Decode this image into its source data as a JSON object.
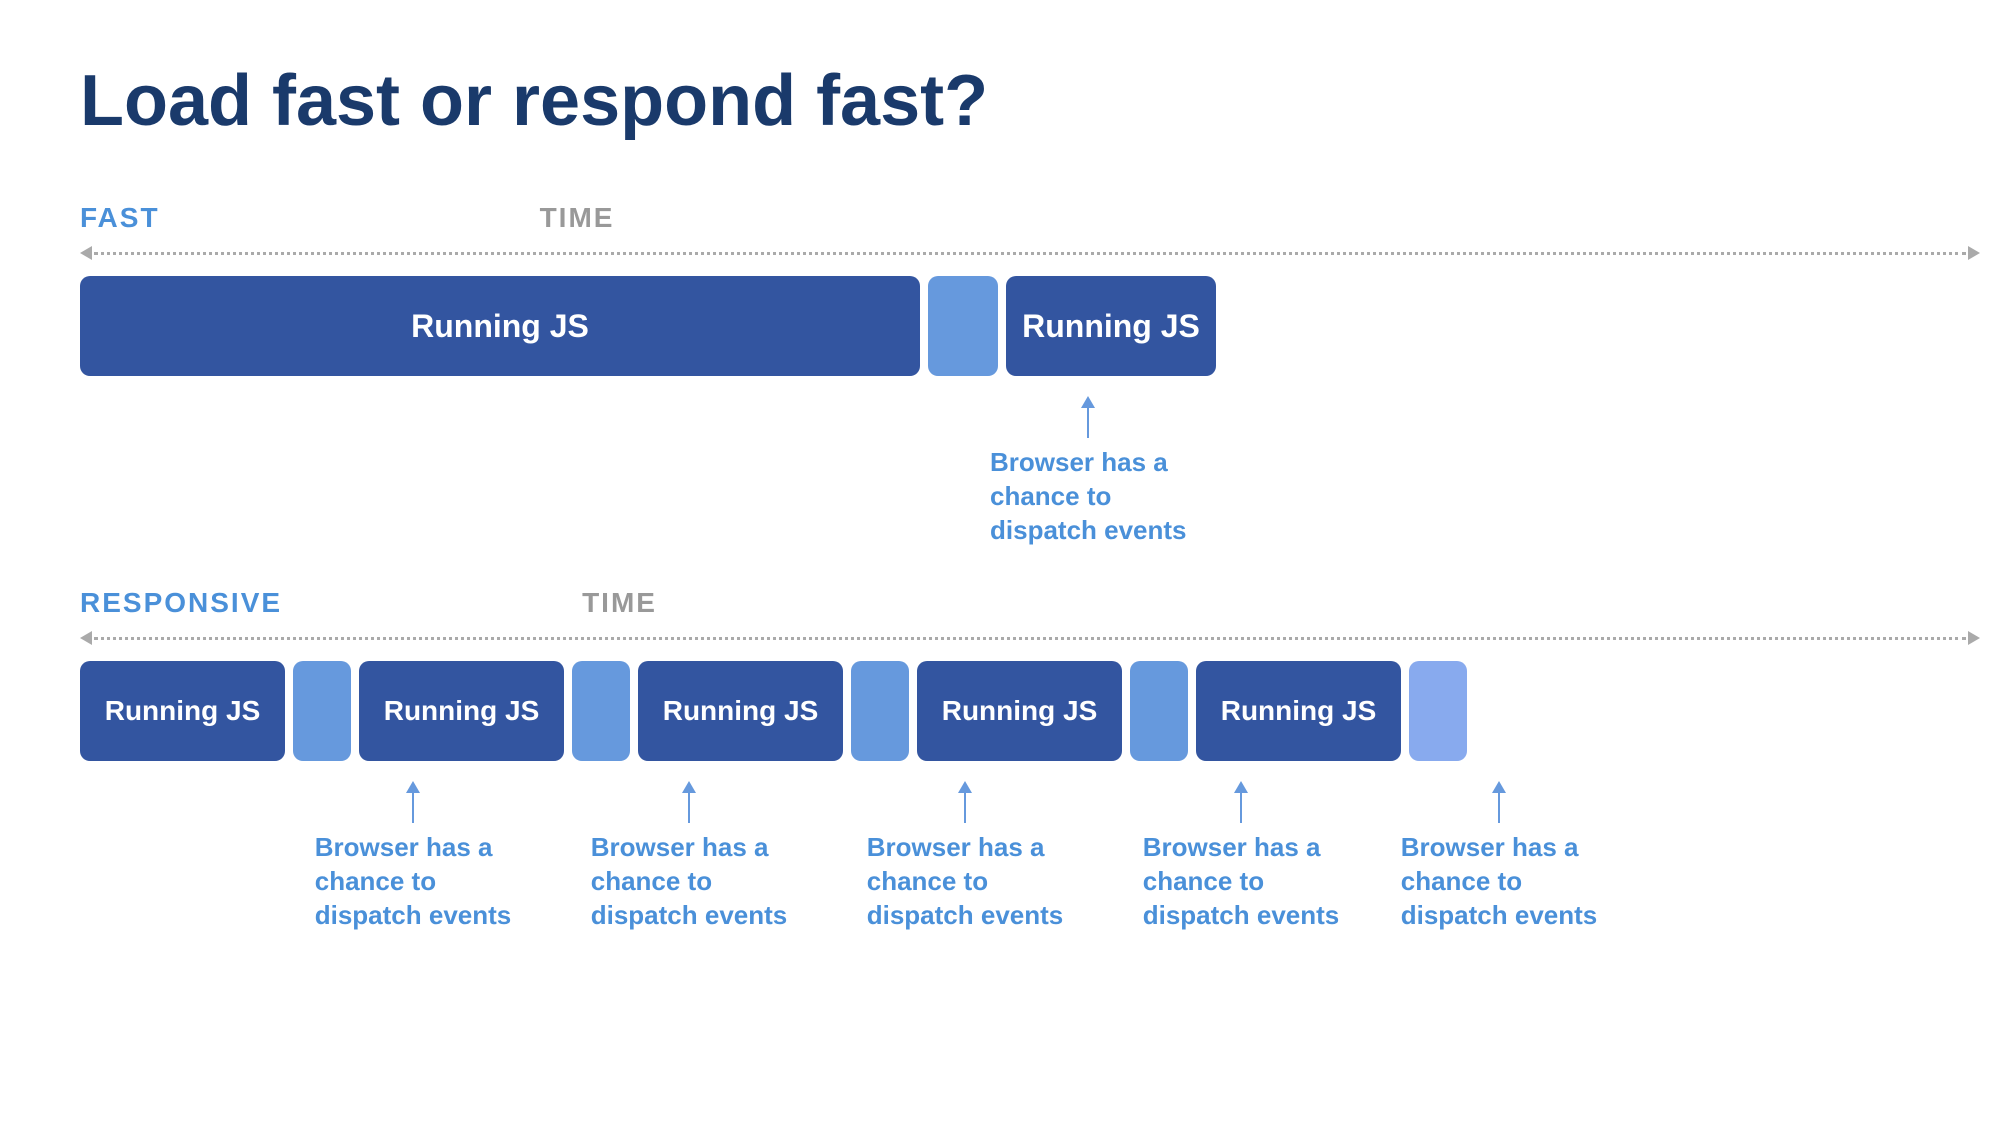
{
  "title": "Load fast or respond fast?",
  "fast_section": {
    "label": "FAST",
    "time_label": "TIME",
    "main_block_label": "Running JS",
    "gap_block_label": "",
    "second_block_label": "Running JS",
    "annotation_text": "Browser has a\nchance to\ndispatch events"
  },
  "responsive_section": {
    "label": "RESPONSIVE",
    "time_label": "TIME",
    "blocks": [
      {
        "type": "dark",
        "label": "Running JS"
      },
      {
        "type": "light",
        "label": ""
      },
      {
        "type": "dark",
        "label": "Running JS"
      },
      {
        "type": "light",
        "label": ""
      },
      {
        "type": "dark",
        "label": "Running JS"
      },
      {
        "type": "light",
        "label": ""
      },
      {
        "type": "dark",
        "label": "Running JS"
      },
      {
        "type": "light",
        "label": ""
      },
      {
        "type": "dark",
        "label": "Running JS"
      },
      {
        "type": "light",
        "label": ""
      }
    ],
    "annotation_text": "Browser has a\nchance to\ndispatch events",
    "annotation_count": 5
  }
}
